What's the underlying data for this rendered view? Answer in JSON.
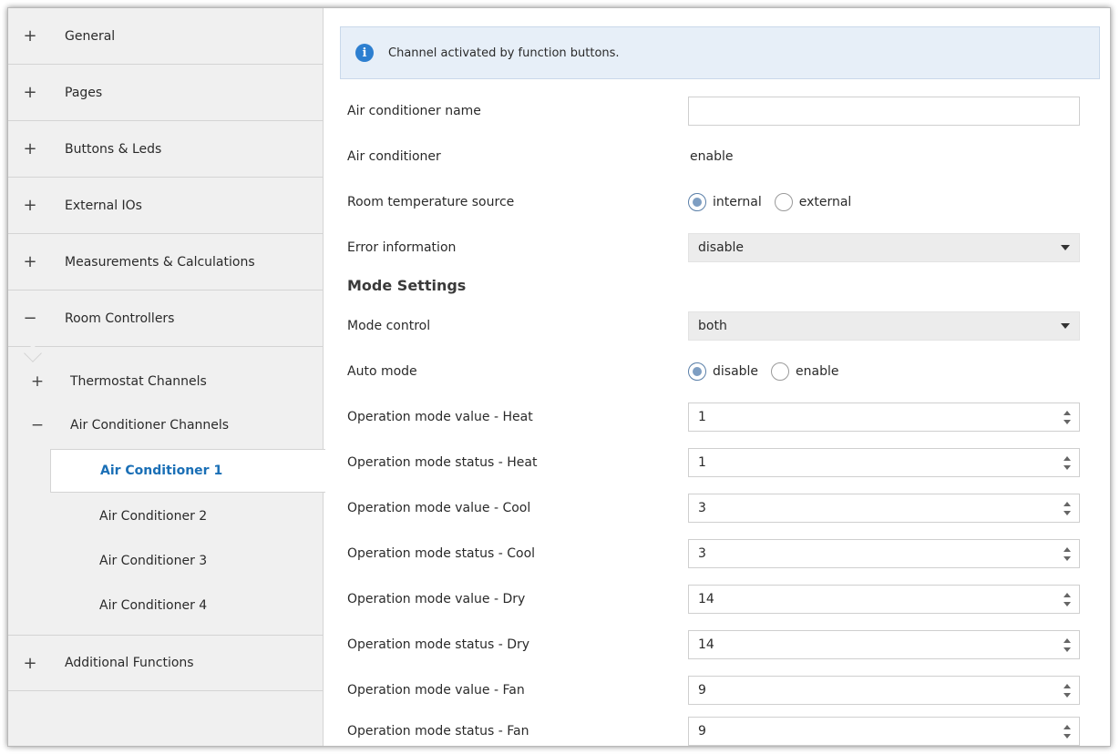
{
  "sidebar": {
    "items": [
      {
        "sign": "+",
        "label": "General"
      },
      {
        "sign": "+",
        "label": "Pages"
      },
      {
        "sign": "+",
        "label": "Buttons & Leds"
      },
      {
        "sign": "+",
        "label": "External IOs"
      },
      {
        "sign": "+",
        "label": "Measurements & Calculations"
      },
      {
        "sign": "−",
        "label": "Room Controllers"
      }
    ],
    "sub_items": [
      {
        "sign": "+",
        "label": "Thermostat Channels"
      },
      {
        "sign": "−",
        "label": "Air Conditioner Channels"
      }
    ],
    "leaf_items": [
      {
        "label": "Air Conditioner 1",
        "active": true
      },
      {
        "label": "Air Conditioner 2"
      },
      {
        "label": "Air Conditioner 3"
      },
      {
        "label": "Air Conditioner 4"
      }
    ],
    "bottom_item": {
      "sign": "+",
      "label": "Additional Functions"
    }
  },
  "main": {
    "banner": {
      "icon": "info-icon",
      "text": "Channel activated by function buttons."
    },
    "ac_name": {
      "label": "Air conditioner name",
      "value": ""
    },
    "ac": {
      "label": "Air conditioner",
      "value": "enable"
    },
    "room_temp": {
      "label": "Room temperature source",
      "options": [
        "internal",
        "external"
      ],
      "selected": "internal"
    },
    "error_info": {
      "label": "Error information",
      "value": "disable"
    },
    "mode_settings_title": "Mode Settings",
    "mode_control": {
      "label": "Mode control",
      "value": "both"
    },
    "auto_mode": {
      "label": "Auto mode",
      "options": [
        "disable",
        "enable"
      ],
      "selected": "disable"
    },
    "op_modes": [
      {
        "label": "Operation mode value - Heat",
        "value": "1"
      },
      {
        "label": "Operation mode status - Heat",
        "value": "1"
      },
      {
        "label": "Operation mode value - Cool",
        "value": "3"
      },
      {
        "label": "Operation mode status - Cool",
        "value": "3"
      },
      {
        "label": "Operation mode value - Dry",
        "value": "14"
      },
      {
        "label": "Operation mode status - Dry",
        "value": "14"
      },
      {
        "label": "Operation mode value - Fan",
        "value": "9"
      },
      {
        "label": "Operation mode status - Fan",
        "value": "9"
      }
    ]
  },
  "colors": {
    "accent": "#1a6fb6",
    "banner_bg": "#e7eff8",
    "info_icon": "#2d7fd0",
    "sidebar_bg": "#f0f0f0"
  }
}
